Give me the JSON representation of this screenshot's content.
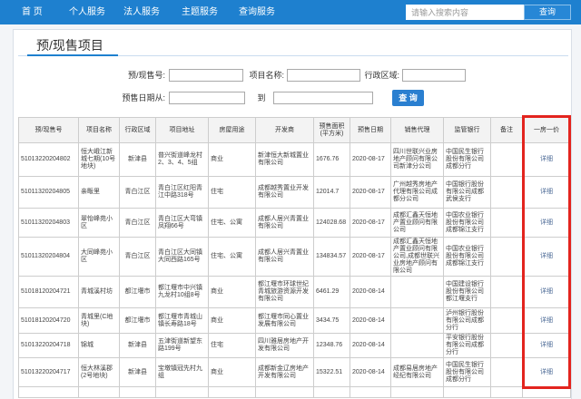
{
  "nav": {
    "items": [
      "首 页",
      "个人服务",
      "法人服务",
      "主题服务",
      "查询服务"
    ],
    "search_placeholder": "请输入搜索内容",
    "search_button": "查询"
  },
  "page": {
    "title": "预/现售项目"
  },
  "filters": {
    "presale_no_label": "预/现售号:",
    "project_name_label": "项目名称:",
    "district_label": "行政区域:",
    "date_from_label": "预售日期从:",
    "date_to_label": "到",
    "submit_label": "查 询"
  },
  "table": {
    "headers": [
      "预/现售号",
      "项目名称",
      "行政区域",
      "项目地址",
      "房屋用途",
      "开发商",
      "预售面积(平方米)",
      "预售日期",
      "销售代理",
      "监管银行",
      "备注",
      "一房一价"
    ],
    "rows": [
      [
        "51013220204802",
        "恒大峨江新城七期(10号地块)",
        "新津县",
        "普兴街道峰龙村2、3、4、5组",
        "商业",
        "新津恒大新城置业有限公司",
        "1676.76",
        "2020-08-17",
        "四川世联兴业房地产顾问有限公司新津分公司",
        "中国民生银行股份有限公司成都分行",
        "",
        "详细"
      ],
      [
        "51011320204805",
        "亲畈里",
        "青白江区",
        "青白江区红阳青江中路318号",
        "住宅",
        "成都越秀置业开发有限公司",
        "12014.7",
        "2020-08-17",
        "广州越秀房地产代理有限公司成都分公司",
        "中国银行股份有限公司成都武侯支行",
        "",
        "详细"
      ],
      [
        "51011320204803",
        "翠怡峰苑小区",
        "青白江区",
        "青白江区大弯镇凤翔66号",
        "住宅、公寓",
        "成都人居兴青置业有限公司",
        "124028.68",
        "2020-08-17",
        "成都汇鑫天恒地产置业顾问有限公司",
        "中国农业银行股份有限公司成都锦江支行",
        "",
        "详细"
      ],
      [
        "51011320204804",
        "大同峰苑小区",
        "青白江区",
        "青白江区大同镇大同西路165号",
        "住宅、公寓",
        "成都人居兴青置业有限公司",
        "134834.57",
        "2020-08-17",
        "成都汇鑫天恒地产置业顾问有限公司,成都世联兴业房地产顾问有限公司",
        "中国农业银行股份有限公司成都锦江支行",
        "",
        "详细"
      ],
      [
        "51018120204721",
        "青城溪村坊",
        "都江堰市",
        "都江堰市中兴镇九龙村10组8号",
        "商业",
        "都江堰市环球世纪青城旅游资源开发有限公司",
        "6461.29",
        "2020-08-14",
        "",
        "中国建设银行股份有限公司都江堰支行",
        "",
        "详细"
      ],
      [
        "51018120204720",
        "青城里(C地块)",
        "都江堰市",
        "都江堰市青城山镇长寿路18号",
        "商业",
        "都江堰市同心置业发展有限公司",
        "3434.75",
        "2020-08-14",
        "",
        "泸州银行股份有限公司成都分行",
        "",
        "详细"
      ],
      [
        "51013220204718",
        "锦城",
        "新津县",
        "五津街道新望东路199号",
        "住宅",
        "四川雅居房地产开发有限公司",
        "12348.76",
        "2020-08-14",
        "",
        "平安银行股份有限公司成都分行",
        "",
        "详细"
      ],
      [
        "51013220204717",
        "恒大林溪郡(2号地块)",
        "新津县",
        "宝墩镇冠先村九组",
        "商业",
        "成都新金辽房地产开发有限公司",
        "15322.51",
        "2020-08-14",
        "成都易居房地产经纪有限公司",
        "中国民生银行股份有限公司成都分行",
        "",
        "详细"
      ]
    ]
  },
  "colors": {
    "nav_bg": "#1e80cf",
    "highlight_border": "#e3241e"
  }
}
